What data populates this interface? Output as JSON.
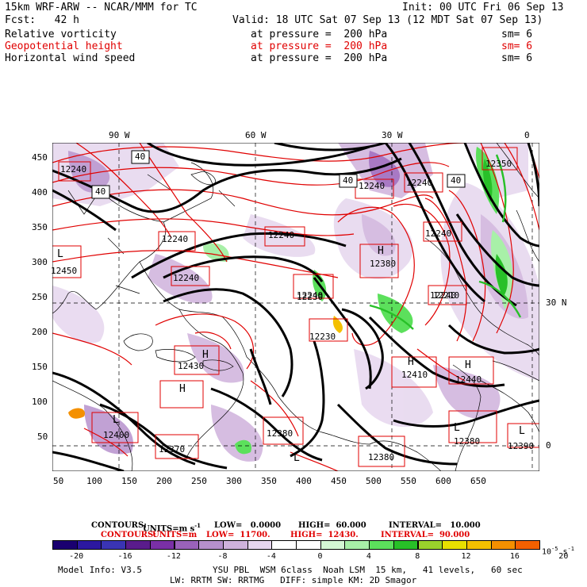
{
  "header": {
    "title": "15km WRF-ARW -- NCAR/MMM for TC",
    "init": "Init: 00 UTC Fri 06 Sep 13",
    "fcst": "Fcst:   42 h",
    "valid": "Valid: 18 UTC Sat 07 Sep 13 (12 MDT Sat 07 Sep 13)"
  },
  "fields": [
    {
      "name": "Relative vorticity",
      "pressure": "at pressure =  200 hPa",
      "sm": "sm= 6",
      "color": "#000000"
    },
    {
      "name": "Geopotential height",
      "pressure": "at pressure =  200 hPa",
      "sm": "sm= 6",
      "color": "#e00000"
    },
    {
      "name": "Horizontal wind speed",
      "pressure": "at pressure =  200 hPa",
      "sm": "sm= 6",
      "color": "#000000"
    }
  ],
  "map": {
    "lon_labels": [
      "90 W",
      "60 W",
      "30 W",
      "0"
    ],
    "lat_labels": [
      "30 N",
      "0"
    ],
    "x_ticks": [
      "50",
      "100",
      "150",
      "200",
      "250",
      "300",
      "350",
      "400",
      "450",
      "500",
      "550",
      "600",
      "650"
    ],
    "y_ticks": [
      "450",
      "400",
      "350",
      "300",
      "250",
      "200",
      "150",
      "100",
      "50"
    ],
    "height_labels": [
      "12240",
      "12240",
      "12240",
      "12240",
      "12240",
      "12240",
      "12240",
      "12240",
      "12240",
      "12380",
      "12430",
      "12410",
      "12400",
      "12380",
      "12380",
      "12380",
      "12370",
      "12390",
      "12450",
      "12440",
      "12230",
      "12210",
      "12230",
      "12350"
    ],
    "h_labels": [
      "H",
      "H",
      "H",
      "H",
      "H"
    ],
    "l_labels": [
      "L",
      "L",
      "L",
      "L",
      "L"
    ],
    "speed_labels": [
      "40",
      "40",
      "40",
      "40"
    ]
  },
  "contours": {
    "black": {
      "prefix": "CONTOURS:",
      "units": "UNITS=m s",
      "units_sup": "-1",
      "low": "LOW=   0.0000",
      "high": "HIGH=  60.000",
      "interval": "INTERVAL=   10.000"
    },
    "red": {
      "prefix": "CONTOURS:",
      "units": "UNITS=m",
      "low": "LOW=  11700.",
      "high": "HIGH=  12430.",
      "interval": "INTERVAL=  90.000"
    }
  },
  "colorbar": {
    "colors": [
      "#1a0070",
      "#2c18a0",
      "#3a34b4",
      "#5a1c8c",
      "#7a30a6",
      "#9a62ba",
      "#b690cc",
      "#cfb2dc",
      "#e6d6ee",
      "#ffffff",
      "#ffffff",
      "#d4f7d4",
      "#a8f0a8",
      "#5ce05c",
      "#28c028",
      "#9ad22c",
      "#e8e000",
      "#f4c000",
      "#f49000",
      "#f46000"
    ],
    "ticks": [
      "-20",
      "-16",
      "-12",
      "-8",
      "-4",
      "0",
      "4",
      "8",
      "12",
      "16",
      "20"
    ],
    "units": "10",
    "units_sup": "-5",
    "units_tail": "s",
    "units_tail_sup": "-1"
  },
  "footer": {
    "model_info": "Model Info: V3.5",
    "physics1": "YSU PBL  WSM 6class  Noah LSM  15 km,   41 levels,   60 sec",
    "physics2": "LW: RRTM SW: RRTMG   DIFF: simple KM: 2D Smagor"
  }
}
